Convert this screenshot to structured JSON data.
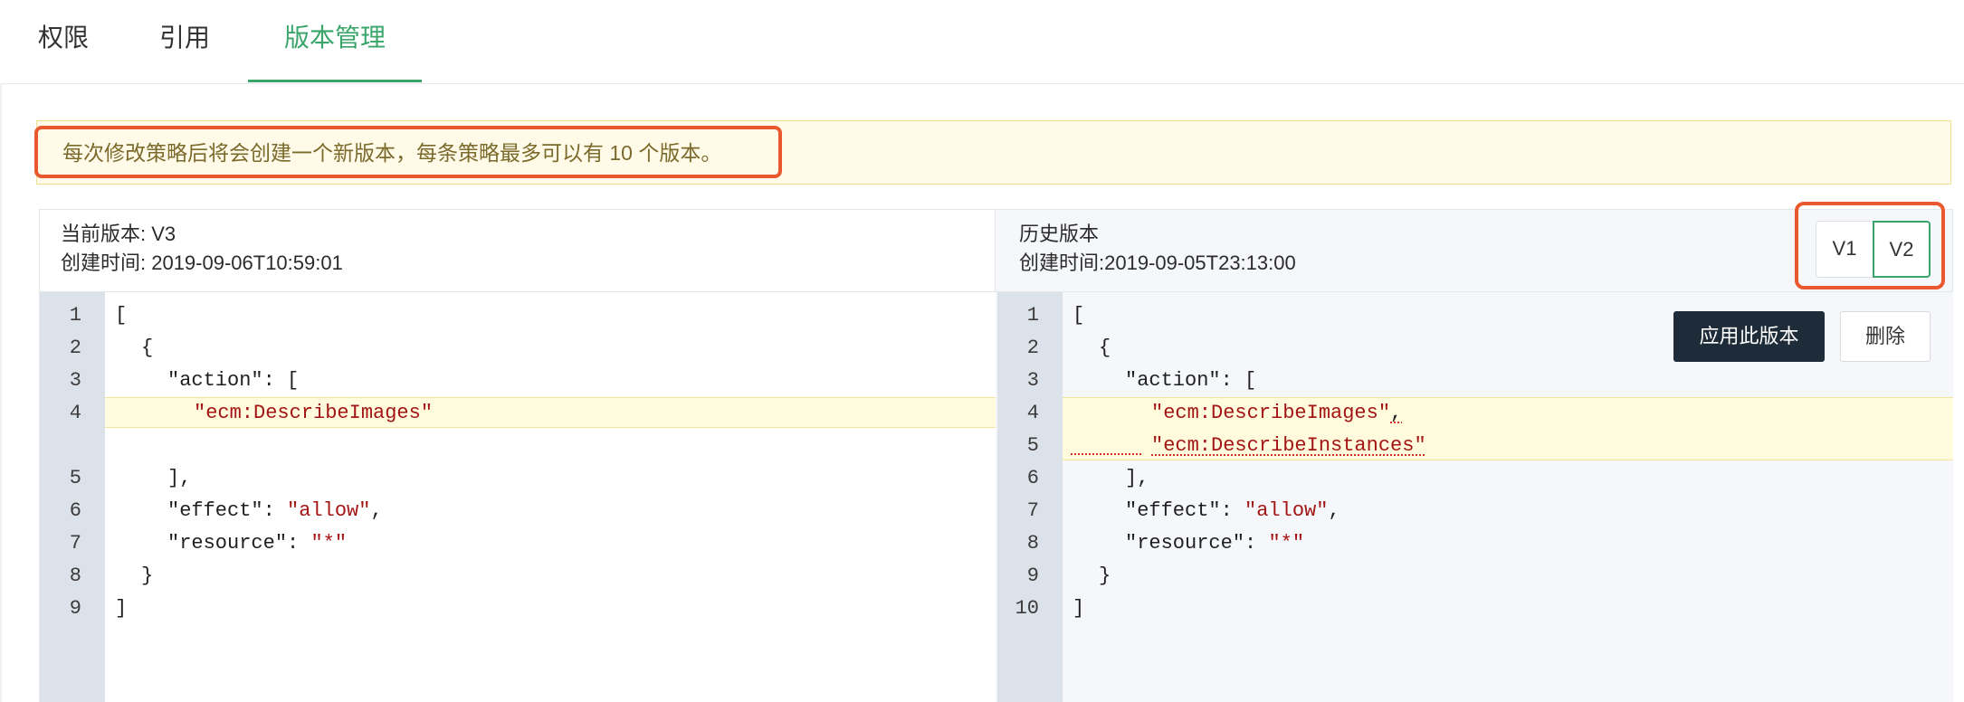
{
  "tabs": [
    {
      "label": "权限"
    },
    {
      "label": "引用"
    },
    {
      "label": "版本管理",
      "active": true
    }
  ],
  "colors": {
    "accent": "#3aa56a",
    "highlight_box": "#e9582e",
    "primary_button": "#1e2b38"
  },
  "notice": {
    "text": "每次修改策略后将会创建一个新版本，每条策略最多可以有 10 个版本。"
  },
  "current_version": {
    "version_line": "当前版本: V3",
    "created_line": "创建时间: 2019-09-06T10:59:01",
    "line_numbers": [
      "1",
      "2",
      "3",
      "4",
      "5",
      "6",
      "7",
      "8",
      "9"
    ],
    "code": {
      "l1": "[",
      "l2": "{",
      "l3_key": "\"action\"",
      "l3_rest": ": [",
      "l4_str": "\"ecm:DescribeImages\"",
      "l5": "],",
      "l6_key": "\"effect\"",
      "l6_sep": ": ",
      "l6_val": "\"allow\"",
      "l6_end": ",",
      "l7_key": "\"resource\"",
      "l7_sep": ": ",
      "l7_val": "\"*\"",
      "l8": "}",
      "l9": "]"
    }
  },
  "history_version": {
    "title": "历史版本",
    "created_line": "创建时间:2019-09-05T23:13:00",
    "versions": [
      {
        "label": "V1"
      },
      {
        "label": "V2",
        "selected": true
      }
    ],
    "apply_label": "应用此版本",
    "delete_label": "删除",
    "line_numbers": [
      "1",
      "2",
      "3",
      "4",
      "5",
      "6",
      "7",
      "8",
      "9",
      "10"
    ],
    "code": {
      "l1": "[",
      "l2": "{",
      "l3_key": "\"action\"",
      "l3_rest": ": [",
      "l4_str": "\"ecm:DescribeImages\"",
      "l4_comma": ",",
      "l5_str": "\"ecm:DescribeInstances\"",
      "l6": "],",
      "l7_key": "\"effect\"",
      "l7_sep": ": ",
      "l7_val": "\"allow\"",
      "l7_end": ",",
      "l8_key": "\"resource\"",
      "l8_sep": ": ",
      "l8_val": "\"*\"",
      "l9": "}",
      "l10": "]"
    }
  }
}
